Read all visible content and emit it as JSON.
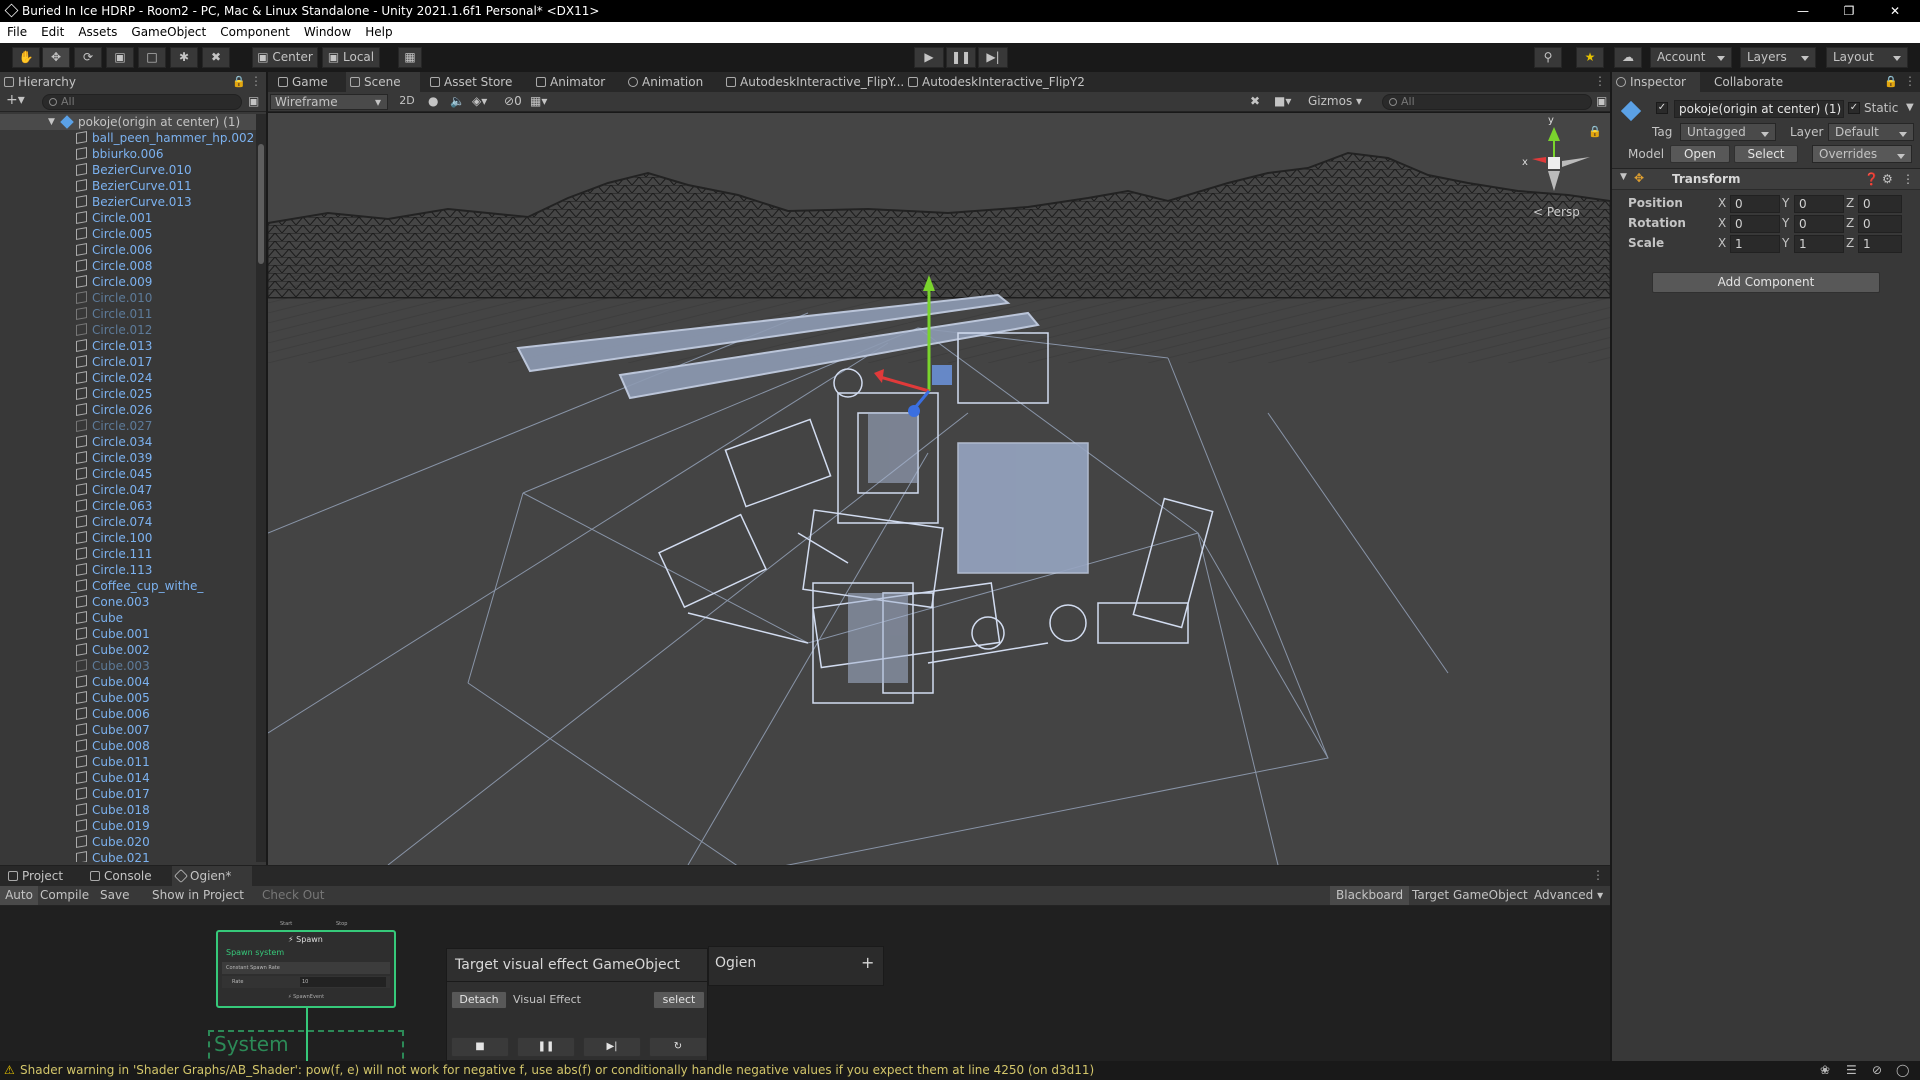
{
  "titlebar": {
    "title": "Buried In Ice HDRP - Room2 - PC, Mac & Linux Standalone - Unity 2021.1.6f1 Personal* <DX11>"
  },
  "menu": [
    "File",
    "Edit",
    "Assets",
    "GameObject",
    "Component",
    "Window",
    "Help"
  ],
  "toolbar": {
    "center": "Center",
    "local": "Local",
    "account": "Account",
    "layers": "Layers",
    "layout": "Layout"
  },
  "hierarchy": {
    "tab": "Hierarchy",
    "search_placeholder": "All",
    "root": "pokoje(origin at center) (1)",
    "items": [
      {
        "name": "ball_peen_hammer_hp.002",
        "dim": false
      },
      {
        "name": "bbiurko.006",
        "dim": false
      },
      {
        "name": "BezierCurve.010",
        "dim": false
      },
      {
        "name": "BezierCurve.011",
        "dim": false
      },
      {
        "name": "BezierCurve.013",
        "dim": false
      },
      {
        "name": "Circle.001",
        "dim": false
      },
      {
        "name": "Circle.005",
        "dim": false
      },
      {
        "name": "Circle.006",
        "dim": false
      },
      {
        "name": "Circle.008",
        "dim": false
      },
      {
        "name": "Circle.009",
        "dim": false
      },
      {
        "name": "Circle.010",
        "dim": true
      },
      {
        "name": "Circle.011",
        "dim": true
      },
      {
        "name": "Circle.012",
        "dim": true
      },
      {
        "name": "Circle.013",
        "dim": false
      },
      {
        "name": "Circle.017",
        "dim": false
      },
      {
        "name": "Circle.024",
        "dim": false
      },
      {
        "name": "Circle.025",
        "dim": false
      },
      {
        "name": "Circle.026",
        "dim": false
      },
      {
        "name": "Circle.027",
        "dim": true
      },
      {
        "name": "Circle.034",
        "dim": false
      },
      {
        "name": "Circle.039",
        "dim": false
      },
      {
        "name": "Circle.045",
        "dim": false
      },
      {
        "name": "Circle.047",
        "dim": false
      },
      {
        "name": "Circle.063",
        "dim": false
      },
      {
        "name": "Circle.074",
        "dim": false
      },
      {
        "name": "Circle.100",
        "dim": false
      },
      {
        "name": "Circle.111",
        "dim": false
      },
      {
        "name": "Circle.113",
        "dim": false
      },
      {
        "name": "Coffee_cup_withe_",
        "dim": false
      },
      {
        "name": "Cone.003",
        "dim": false
      },
      {
        "name": "Cube",
        "dim": false
      },
      {
        "name": "Cube.001",
        "dim": false
      },
      {
        "name": "Cube.002",
        "dim": false
      },
      {
        "name": "Cube.003",
        "dim": true
      },
      {
        "name": "Cube.004",
        "dim": false
      },
      {
        "name": "Cube.005",
        "dim": false
      },
      {
        "name": "Cube.006",
        "dim": false
      },
      {
        "name": "Cube.007",
        "dim": false
      },
      {
        "name": "Cube.008",
        "dim": false
      },
      {
        "name": "Cube.011",
        "dim": false
      },
      {
        "name": "Cube.014",
        "dim": false
      },
      {
        "name": "Cube.017",
        "dim": false
      },
      {
        "name": "Cube.018",
        "dim": false
      },
      {
        "name": "Cube.019",
        "dim": false
      },
      {
        "name": "Cube.020",
        "dim": false
      },
      {
        "name": "Cube.021",
        "dim": false
      }
    ]
  },
  "scene_tabs": [
    "Game",
    "Scene",
    "Asset Store",
    "Animator",
    "Animation",
    "AutodeskInteractive_FlipY...",
    "AutodeskInteractive_FlipY2"
  ],
  "scene_bar": {
    "shading": "Wireframe",
    "mode2d": "2D",
    "hidden_count": "0",
    "gizmos": "Gizmos",
    "search_placeholder": "All",
    "persp": "< Persp"
  },
  "inspector": {
    "tabs": [
      "Inspector",
      "Collaborate"
    ],
    "object_name": "pokoje(origin at center) (1)",
    "static_label": "Static",
    "tag_label": "Tag",
    "tag_value": "Untagged",
    "layer_label": "Layer",
    "layer_value": "Default",
    "model_label": "Model",
    "open": "Open",
    "select": "Select",
    "overrides": "Overrides",
    "transform": "Transform",
    "rows": [
      {
        "label": "Position",
        "x": "0",
        "y": "0",
        "z": "0"
      },
      {
        "label": "Rotation",
        "x": "0",
        "y": "0",
        "z": "0"
      },
      {
        "label": "Scale",
        "x": "1",
        "y": "1",
        "z": "1"
      }
    ],
    "add_component": "Add Component"
  },
  "bottom": {
    "tabs": [
      "Project",
      "Console",
      "Ogien*"
    ],
    "toolbar": [
      "Auto",
      "Compile",
      "Save",
      "Show in Project",
      "Check Out"
    ],
    "right_buttons": [
      "Blackboard",
      "Target GameObject",
      "Advanced"
    ],
    "node": {
      "start": "Start",
      "stop": "Stop",
      "title": "Spawn",
      "system": "Spawn system",
      "block": "Constant Spawn Rate",
      "rate_label": "Rate",
      "rate_value": "10",
      "event": "SpawnEvent",
      "group": "System"
    },
    "target_panel": {
      "title": "Target visual effect GameObject",
      "detach": "Detach",
      "visual_effect": "Visual Effect",
      "select": "select"
    },
    "blackboard": {
      "title": "Ogien",
      "plus": "+"
    }
  },
  "status": {
    "message": "Shader warning in 'Shader Graphs/AB_Shader': pow(f, e) will not work for negative f, use abs(f) or conditionally handle negative values if you expect them at line 4250 (on d3d11)"
  }
}
